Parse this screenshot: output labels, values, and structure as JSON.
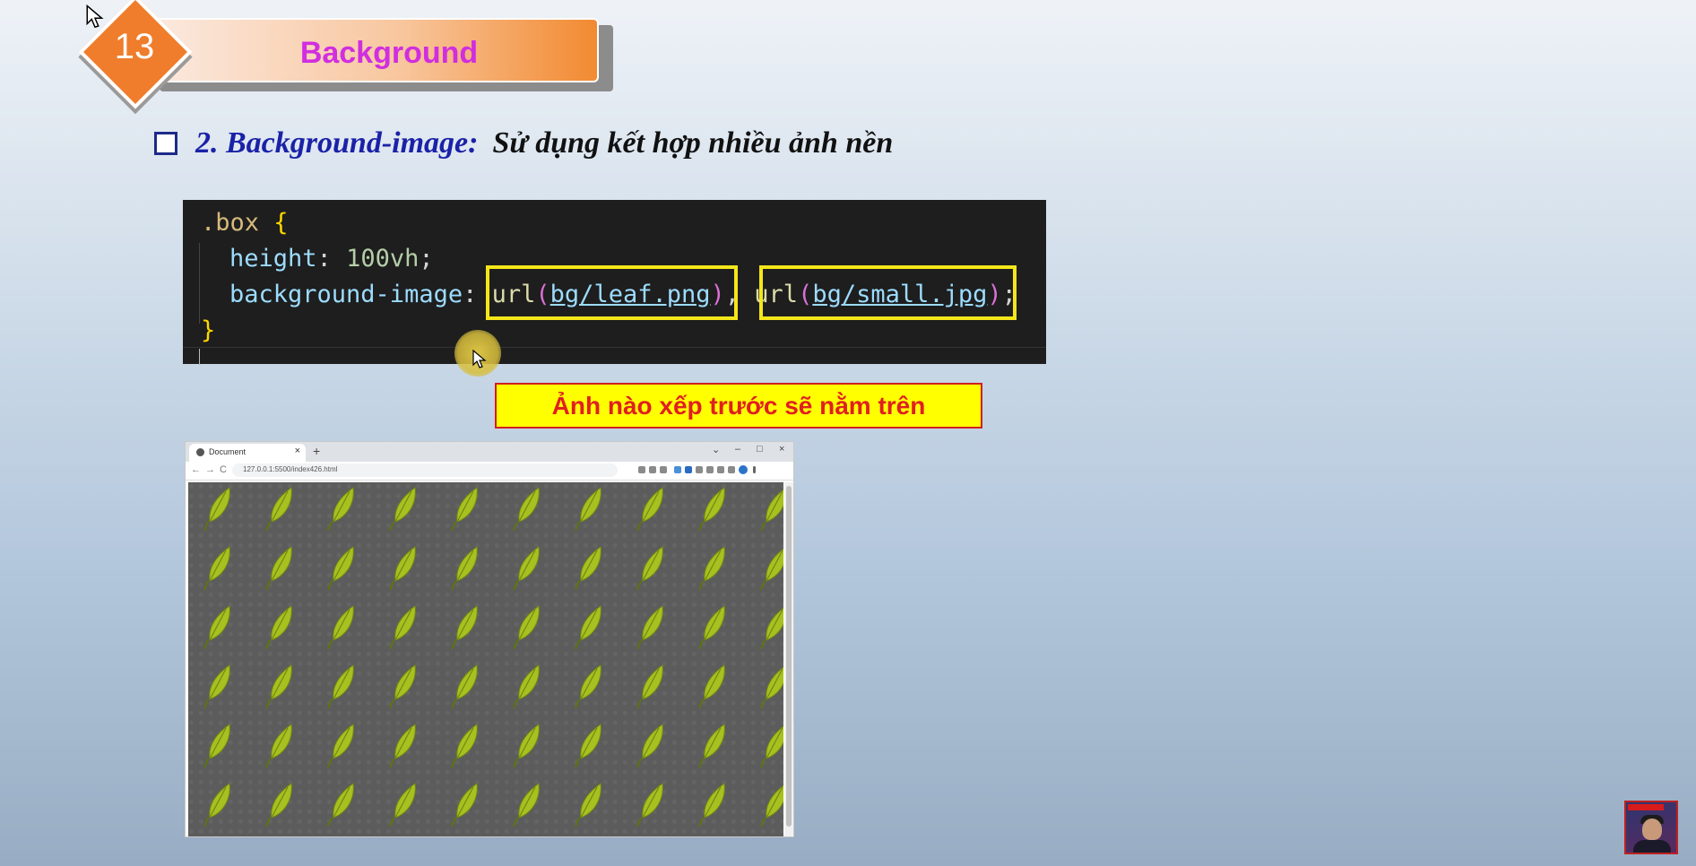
{
  "slide": {
    "number": "13",
    "title": "Background"
  },
  "heading": {
    "number": "2. Background-image:",
    "description": "Sử dụng kết hợp nhiều ảnh nền"
  },
  "code": {
    "selector": ".box",
    "open_brace": "{",
    "close_brace": "}",
    "prop1": "height",
    "val1": "100vh",
    "prop2": "background-image",
    "fn": "url",
    "url1": "bg/leaf.png",
    "url2": "bg/small.jpg",
    "colon": ":",
    "semicolon": ";",
    "comma": ",",
    "paren_open": "(",
    "paren_close": ")"
  },
  "note": "Ảnh nào xếp trước sẽ nằm trên",
  "browser": {
    "tab_title": "Document",
    "tab_close": "×",
    "new_tab": "+",
    "url": "127.0.0.1:5500/index426.html",
    "controls": [
      "⌄",
      "–",
      "□",
      "×"
    ],
    "nav": [
      "←",
      "→",
      "C"
    ]
  },
  "icons": {
    "checkbox": "square-bullet-icon",
    "pointer": "mouse-pointer-icon",
    "leaf": "leaf-icon"
  },
  "colors": {
    "title_text": "#d02ee0",
    "diamond": "#ef7d2b",
    "heading_number": "#1a22a8",
    "note_bg": "#ffff00",
    "note_text": "#e02020",
    "highlight_box": "#f5e61a",
    "leaf": "#a8c020"
  }
}
